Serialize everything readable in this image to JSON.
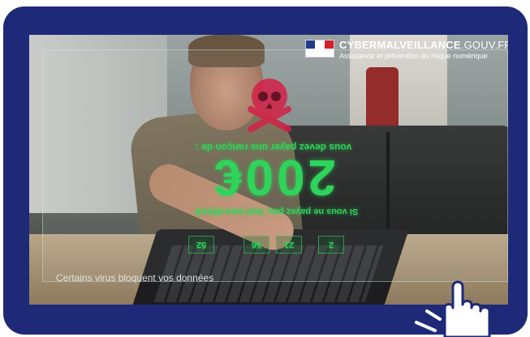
{
  "header": {
    "brand_bold": "CYBERMALVEILLANCE",
    "brand_domain": ".GOUV.FR",
    "tagline": "Assistance et prévention du risque numérique"
  },
  "ransom": {
    "line1": "vous devez payer une rançon de :",
    "amount": "200€",
    "line2": "Si vous ne payez pas, tout sera détruit",
    "counters": [
      "2",
      "21",
      "56",
      "52"
    ]
  },
  "caption": "Certains virus bloquent vos données",
  "icons": [
    "skull-crossbones-icon",
    "pointer-hand-icon",
    "french-flag-icon"
  ],
  "colors": {
    "frame": "#1e2a78",
    "ransom_green": "#2fd45a",
    "skull": "#d42046"
  }
}
